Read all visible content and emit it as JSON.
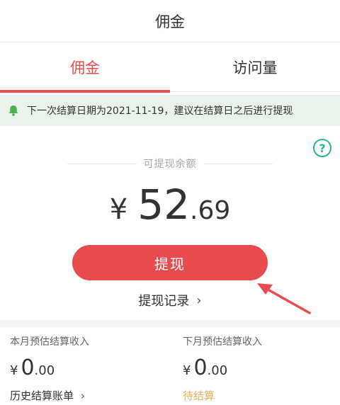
{
  "header": {
    "title": "佣金"
  },
  "tabs": [
    {
      "label": "佣金",
      "active": true
    },
    {
      "label": "访问量",
      "active": false
    }
  ],
  "notice": {
    "icon": "bell-icon",
    "text": "下一次结算日期为2021-11-19，建议在结算日之后进行提现"
  },
  "help": {
    "icon": "question-icon",
    "symbol": "?"
  },
  "balance": {
    "label": "可提现余额",
    "currency": "¥",
    "integer": "52",
    "decimal": ".69"
  },
  "withdraw_button": {
    "label": "提现"
  },
  "record_link": {
    "label": "提现记录",
    "chevron": "›"
  },
  "stats": {
    "this_month": {
      "label": "本月预估结算收入",
      "currency": "¥",
      "integer": "0",
      "decimal": ".00",
      "link": "历史结算账单",
      "chevron": "›"
    },
    "next_month": {
      "label": "下月预估结算收入",
      "currency": "¥",
      "integer": "0",
      "decimal": ".00",
      "status": "待结算"
    }
  },
  "colors": {
    "accent": "#e84c4f",
    "notice_bg": "#eaf3e9",
    "help": "#2bb59a",
    "pending": "#e8b15a"
  }
}
